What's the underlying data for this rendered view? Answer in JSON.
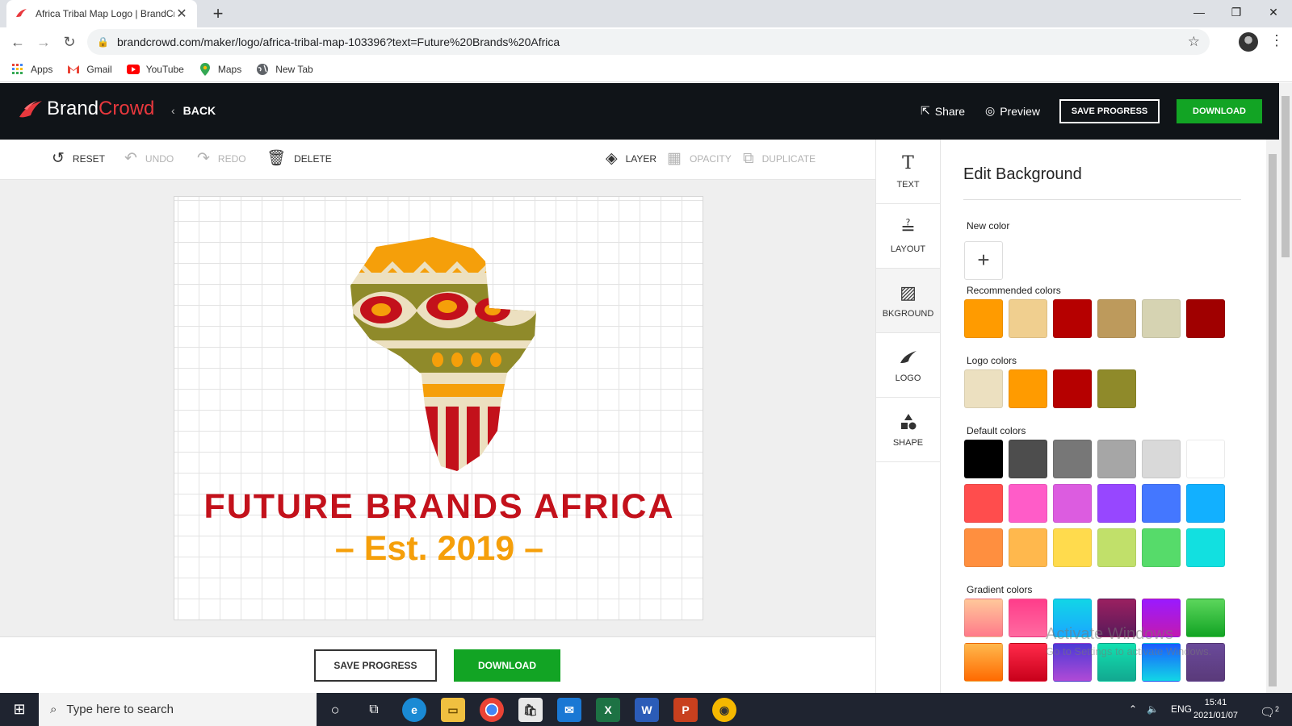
{
  "browser": {
    "tab_title": "Africa Tribal Map Logo | BrandCro",
    "url": "brandcrowd.com/maker/logo/africa-tribal-map-103396?text=Future%20Brands%20Africa",
    "bookmarks": [
      {
        "label": "Apps",
        "icon": "apps-grid-icon"
      },
      {
        "label": "Gmail",
        "icon": "gmail-icon"
      },
      {
        "label": "YouTube",
        "icon": "youtube-icon"
      },
      {
        "label": "Maps",
        "icon": "maps-pin-icon"
      },
      {
        "label": "New Tab",
        "icon": "globe-icon"
      }
    ]
  },
  "header": {
    "brand_part1": "Brand",
    "brand_part2": "Crowd",
    "back_label": "BACK",
    "share_label": "Share",
    "preview_label": "Preview",
    "save_label": "SAVE PROGRESS",
    "download_label": "DOWNLOAD"
  },
  "toolbar": {
    "reset": "RESET",
    "undo": "UNDO",
    "redo": "REDO",
    "delete": "DELETE",
    "layer": "LAYER",
    "opacity": "OPACITY",
    "duplicate": "DUPLICATE"
  },
  "logo": {
    "title": "FUTURE BRANDS AFRICA",
    "subtitle": "– Est. 2019 –",
    "colors": {
      "red": "#c3111b",
      "orange": "#f59f0a",
      "olive": "#8f8a2a",
      "cream": "#ece0c0"
    }
  },
  "bottom": {
    "save_label": "SAVE PROGRESS",
    "download_label": "DOWNLOAD"
  },
  "sidetabs": [
    {
      "label": "TEXT",
      "icon": "text-icon"
    },
    {
      "label": "LAYOUT",
      "icon": "layout-icon"
    },
    {
      "label": "BKGROUND",
      "icon": "background-icon"
    },
    {
      "label": "LOGO",
      "icon": "logo-icon"
    },
    {
      "label": "SHAPE",
      "icon": "shape-icon"
    }
  ],
  "panel": {
    "title": "Edit Background",
    "new_color_label": "New color",
    "recommended_label": "Recommended colors",
    "logo_colors_label": "Logo colors",
    "default_label": "Default colors",
    "gradient_label": "Gradient colors",
    "recommended_colors": [
      "#ff9b00",
      "#f0cf8f",
      "#b60000",
      "#bd9a5c",
      "#d6d3b2",
      "#a00000"
    ],
    "logo_colors": [
      "#ece0c0",
      "#ff9b00",
      "#b60000",
      "#8f8a2a"
    ],
    "default_colors": [
      "#000000",
      "#4d4d4d",
      "#777777",
      "#a6a6a6",
      "#d9d9d9",
      "#ffffff",
      "#ff4d4d",
      "#ff5cc8",
      "#dc5ce0",
      "#9747ff",
      "#4477ff",
      "#12b0ff",
      "#ff8f3f",
      "#ffb84d",
      "#ffdb4d",
      "#c1e06a",
      "#56db6a",
      "#12e0e0"
    ],
    "gradient_colors": [
      [
        "#ffc89a",
        "#ff7a8a"
      ],
      [
        "#ff3c8a",
        "#ff6aa0"
      ],
      [
        "#12d6e6",
        "#1aa8ff"
      ],
      [
        "#9a2060",
        "#5a1a5a"
      ],
      [
        "#9a1aff",
        "#c21ab0"
      ],
      [
        "#5cd65c",
        "#12a424"
      ],
      [
        "#ffb84d",
        "#ff6a00"
      ],
      [
        "#ff2a4a",
        "#c8001a"
      ],
      [
        "#4a3ad6",
        "#b04ad6"
      ],
      [
        "#12e0b0",
        "#12a890"
      ],
      [
        "#1a5aff",
        "#12d6e6"
      ],
      [
        "#6a4a9a",
        "#5a3a7a"
      ]
    ],
    "watermark_line1": "Activate Windows",
    "watermark_line2": "Go to Settings to activate Windows."
  },
  "taskbar": {
    "search_placeholder": "Type here to search",
    "lang": "ENG",
    "time": "15:41",
    "date": "2021/01/07",
    "notification_count": "2"
  }
}
